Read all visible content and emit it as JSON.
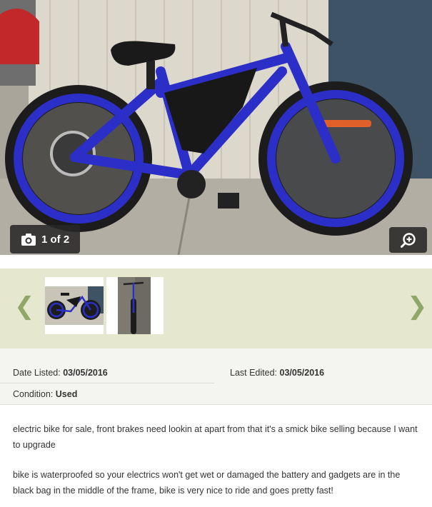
{
  "gallery": {
    "counter_text": "1 of 2",
    "icons": {
      "camera": "camera-icon",
      "zoom": "zoom-in-icon",
      "prev": "chevron-left-icon",
      "next": "chevron-right-icon"
    },
    "prev_arrow": "❮",
    "next_arrow": "❯"
  },
  "details": {
    "date_listed_label": "Date Listed:",
    "date_listed_value": "03/05/2016",
    "last_edited_label": "Last Edited:",
    "last_edited_value": "03/05/2016",
    "condition_label": "Condition:",
    "condition_value": "Used"
  },
  "description": {
    "paragraph_1": "electric bike for sale, front brakes need lookin at apart from that it's a smick bike selling because I want to upgrade",
    "paragraph_2": "bike is waterproofed so your electrics won't get wet or damaged the battery and gadgets are in the black bag in the middle of the frame, bike is very nice to ride and goes pretty fast!"
  },
  "colors": {
    "thumb_strip_bg": "#e5e8cf",
    "details_bg": "#f4f4f1",
    "arrow_color": "#8fa86a",
    "bike_blue": "#2b2fc8"
  }
}
